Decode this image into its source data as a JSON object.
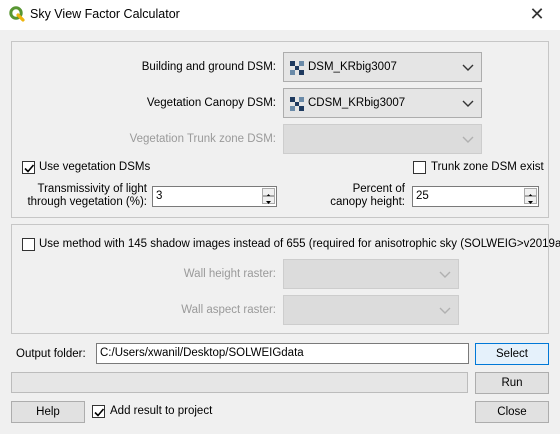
{
  "window": {
    "title": "Sky View Factor Calculator",
    "close_glyph": "✕"
  },
  "inputs": {
    "building_dsm": {
      "label": "Building and ground DSM:",
      "value": "DSM_KRbig3007"
    },
    "vegetation_canopy_dsm": {
      "label": "Vegetation Canopy DSM:",
      "value": "CDSM_KRbig3007"
    },
    "vegetation_trunk_dsm": {
      "label": "Vegetation Trunk zone DSM:",
      "value": ""
    }
  },
  "options": {
    "use_vegetation": {
      "label": "Use vegetation DSMs",
      "checked": true
    },
    "trunk_zone_exist": {
      "label": "Trunk zone DSM exist",
      "checked": false
    },
    "transmissivity": {
      "label_line1": "Transmissivity of light",
      "label_line2": "through vegetation (%):",
      "value": "3"
    },
    "percent_canopy": {
      "label_line1": "Percent of",
      "label_line2": "canopy height:",
      "value": "25"
    }
  },
  "aniso": {
    "label": "Use method with 145 shadow images instead of 655 (required for anisotrophic sky (SOLWEIG>v2019a)",
    "checked": false,
    "wall_height": {
      "label": "Wall height raster:",
      "value": ""
    },
    "wall_aspect": {
      "label": "Wall aspect raster:",
      "value": ""
    }
  },
  "output": {
    "label": "Output folder:",
    "value": "C:/Users/xwanil/Desktop/SOLWEIGdata",
    "select_label": "Select"
  },
  "progress": {
    "value": 0
  },
  "buttons": {
    "run": "Run",
    "help": "Help",
    "close": "Close"
  },
  "add_result": {
    "label": "Add result to project",
    "checked": true
  },
  "colors": {
    "accent": "#0078d7",
    "qgis_green": "#589632"
  }
}
